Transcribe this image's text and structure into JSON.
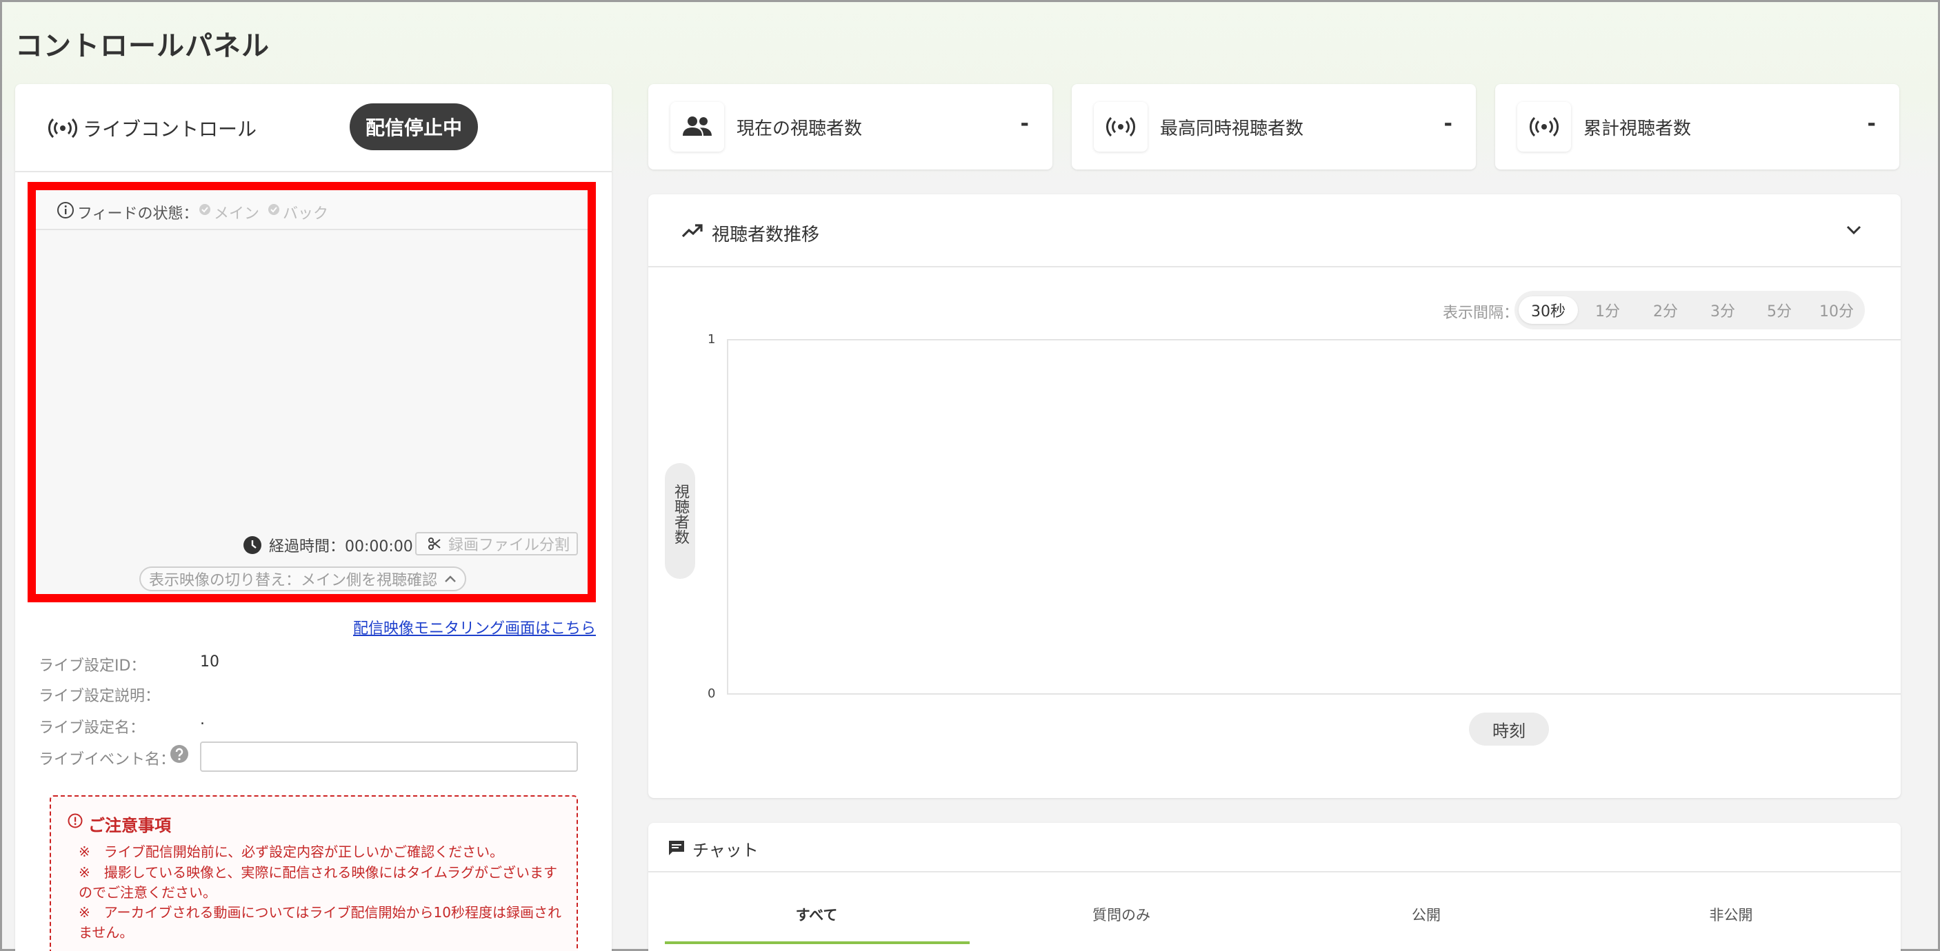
{
  "page": {
    "title": "コントロールパネル"
  },
  "live_control": {
    "label": "ライブコントロール",
    "status": "配信停止中",
    "feed_label": "フィードの状態：",
    "feed_main": "メイン",
    "feed_back": "バック",
    "elapsed": "経過時間：00:00:00",
    "split_button": "録画ファイル分割",
    "switch_view": "表示映像の切り替え：メイン側を視聴確認",
    "monitor_link": "配信映像モニタリング画面はこちら"
  },
  "settings": {
    "id_label": "ライブ設定ID：",
    "id_value": "10",
    "desc_label": "ライブ設定説明：",
    "name_label": "ライブ設定名：",
    "name_value": ".",
    "event_label": "ライブイベント名：",
    "event_value": ""
  },
  "notice": {
    "title": "ご注意事項",
    "items": [
      "※　ライブ配信開始前に、必ず設定内容が正しいかご確認ください。",
      "※　撮影している映像と、実際に配信される映像にはタイムラグがございますのでご注意ください。",
      "※　アーカイブされる動画についてはライブ配信開始から10秒程度は録画されません。"
    ]
  },
  "stats": [
    {
      "label": "現在の視聴者数",
      "value": "-",
      "icon": "people-icon"
    },
    {
      "label": "最高同時視聴者数",
      "value": "-",
      "icon": "broadcast-icon"
    },
    {
      "label": "累計視聴者数",
      "value": "-",
      "icon": "broadcast-icon"
    }
  ],
  "chart": {
    "title": "視聴者数推移",
    "interval_label": "表示間隔："
  },
  "chart_data": {
    "type": "line",
    "title": "視聴者数推移",
    "xlabel": "時刻",
    "ylabel": "視聴者数",
    "ylim": [
      0,
      1
    ],
    "yticks": [
      "1",
      "0"
    ],
    "series": [],
    "intervals": [
      "30秒",
      "1分",
      "2分",
      "3分",
      "5分",
      "10分"
    ],
    "selected_interval": "30秒"
  },
  "chat": {
    "title": "チャット",
    "tabs": [
      "すべて",
      "質問のみ",
      "公開",
      "非公開"
    ],
    "active_tab": "すべて"
  },
  "colors": {
    "accent": "#8bc34a",
    "highlight": "#ff0000",
    "notice": "#c62828",
    "status_bg": "#3d3d3d"
  }
}
